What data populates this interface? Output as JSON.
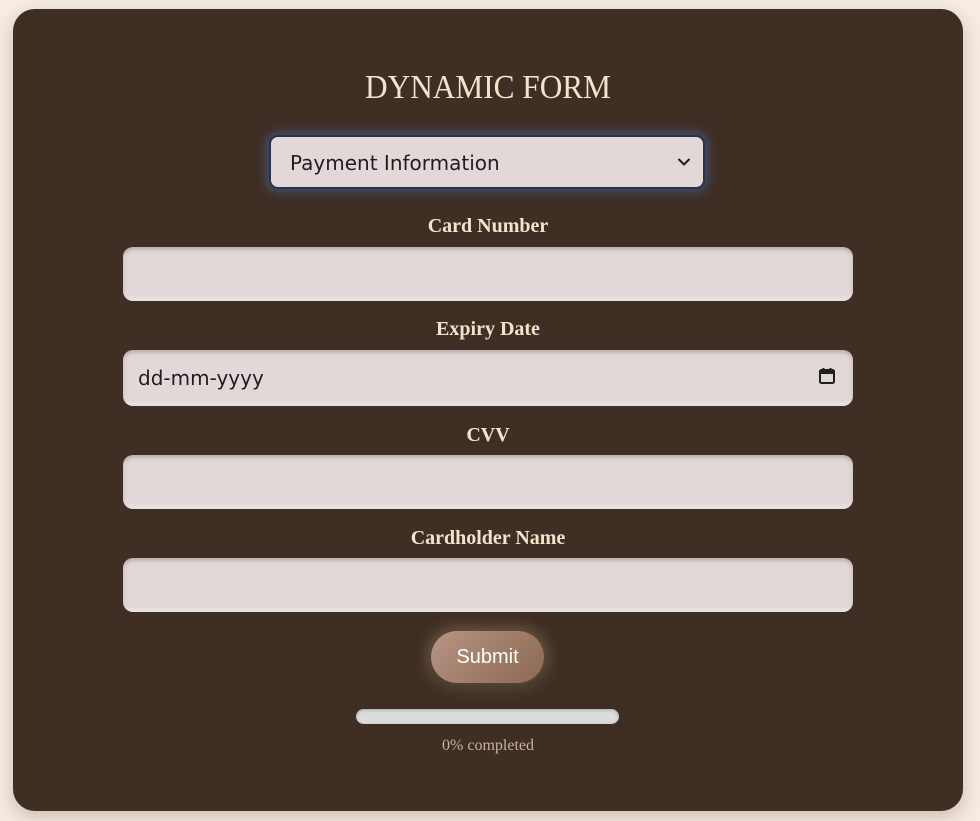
{
  "form": {
    "title": "DYNAMIC FORM",
    "section_select": {
      "selected": "Payment Information"
    },
    "fields": [
      {
        "label": "Card Number",
        "value": "",
        "type": "text"
      },
      {
        "label": "Expiry Date",
        "value": "dd-mm-yyyy",
        "type": "date"
      },
      {
        "label": "CVV",
        "value": "",
        "type": "text"
      },
      {
        "label": "Cardholder Name",
        "value": "",
        "type": "text"
      }
    ],
    "submit_label": "Submit",
    "progress": {
      "percent": 0,
      "text": "0% completed"
    }
  },
  "colors": {
    "background": "#f6ece2",
    "card": "#3f2e24",
    "label_text": "#f4e3cc",
    "input_bg": "#e2d8d8",
    "button": "#8c6852",
    "progress_track": "#dcdcdc",
    "focus_glow": "#466eaa"
  },
  "icons": {
    "select_arrow": "chevron-down-icon",
    "date_picker": "calendar-icon"
  }
}
